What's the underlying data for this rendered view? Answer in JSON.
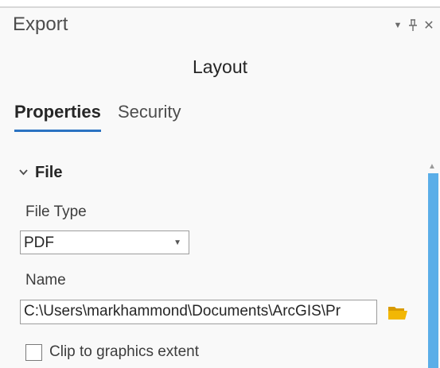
{
  "pane": {
    "title": "Export",
    "menu_icon": "dropdown-menu-icon",
    "pin_icon": "pin-icon",
    "close_icon": "close-icon"
  },
  "layout_title": "Layout",
  "tabs": [
    {
      "label": "Properties",
      "active": true
    },
    {
      "label": "Security",
      "active": false
    }
  ],
  "section": {
    "title": "File",
    "icon": "chevron-down-icon",
    "expanded": true
  },
  "file_type": {
    "label": "File Type",
    "value": "PDF"
  },
  "name": {
    "label": "Name",
    "value": "C:\\Users\\markhammond\\Documents\\ArcGIS\\Pr",
    "browse_icon": "folder-open-icon"
  },
  "clip": {
    "label": "Clip to graphics extent",
    "checked": false
  },
  "colors": {
    "accent": "#2b73c2",
    "scrollbar": "#5aaee8",
    "folder": "#f2b705"
  }
}
